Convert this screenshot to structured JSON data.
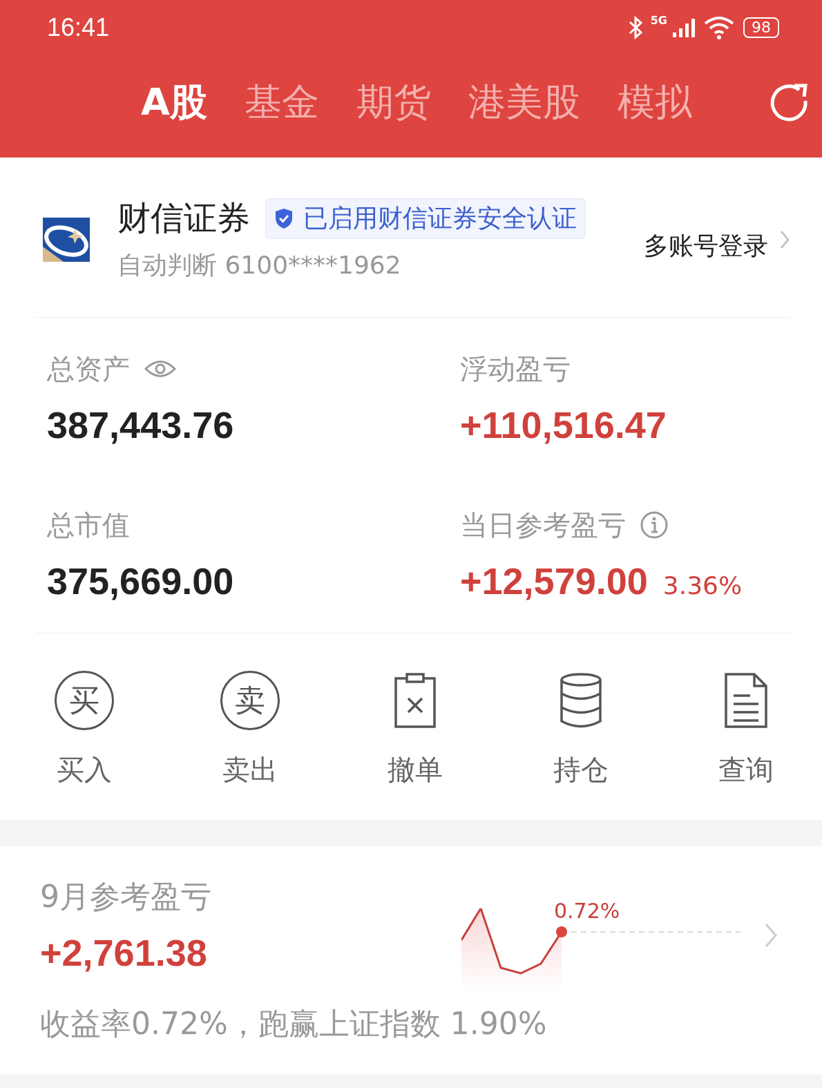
{
  "status_bar": {
    "time": "16:41",
    "network": "5G",
    "battery": "98"
  },
  "tabs": [
    {
      "label": "A股",
      "selected": true
    },
    {
      "label": "基金",
      "selected": false
    },
    {
      "label": "期货",
      "selected": false
    },
    {
      "label": "港美股",
      "selected": false
    },
    {
      "label": "模拟",
      "selected": false
    }
  ],
  "account": {
    "broker": "财信证券",
    "badge": "已启用财信证券安全认证",
    "account_line": "自动判断 6100****1962",
    "multi_login": "多账号登录"
  },
  "metrics": [
    {
      "label": "总资产",
      "value": "387,443.76",
      "kind": "plain"
    },
    {
      "label": "浮动盈亏",
      "value": "+110,516.47",
      "kind": "gain"
    },
    {
      "label": "总市值",
      "value": "375,669.00",
      "kind": "plain"
    },
    {
      "label": "当日参考盈亏",
      "value": "+12,579.00",
      "percent": "3.36%",
      "kind": "gain"
    }
  ],
  "actions": [
    {
      "label": "买入",
      "kind": "glyph",
      "glyph": "买"
    },
    {
      "label": "卖出",
      "kind": "glyph",
      "glyph": "卖"
    },
    {
      "label": "撤单",
      "kind": "cancel"
    },
    {
      "label": "持仓",
      "kind": "database"
    },
    {
      "label": "查询",
      "kind": "document"
    }
  ],
  "monthly": {
    "title": "9月参考盈亏",
    "value": "+2,761.38",
    "summary": "收益率0.72%，跑赢上证指数 1.90%",
    "chart_label": "0.72%"
  }
}
